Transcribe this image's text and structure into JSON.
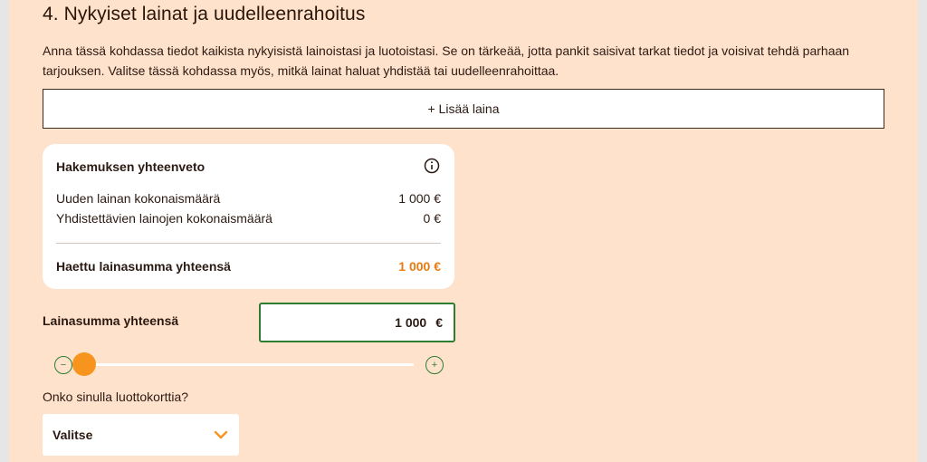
{
  "section": {
    "title": "4. Nykyiset lainat ja uudelleenrahoitus",
    "description": "Anna tässä kohdassa tiedot kaikista nykyisistä lainoistasi ja luotoistasi. Se on tärkeää, jotta pankit saisivat tarkat tiedot ja voisivat tehdä parhaan tarjouksen. Valitse tässä kohdassa myös, mitkä lainat haluat yhdistää tai uudelleenrahoittaa."
  },
  "add_loan": {
    "label": "+ Lisää laina"
  },
  "summary": {
    "heading": "Hakemuksen yhteenveto",
    "rows": [
      {
        "label": "Uuden lainan kokonaismäärä",
        "value": "1 000 €"
      },
      {
        "label": "Yhdistettävien lainojen kokonaismäärä",
        "value": "0 €"
      }
    ],
    "total": {
      "label": "Haettu lainasumma yhteensä",
      "value": "1 000 €"
    }
  },
  "amount": {
    "label": "Lainasumma yhteensä",
    "value": "1 000",
    "unit": "€",
    "slider_fraction": 0.0
  },
  "credit_card": {
    "question": "Onko sinulla luottokorttia?",
    "select_value": "Valitse"
  },
  "colors": {
    "background": "#ffe2cc",
    "accent": "#f7941d",
    "total_value": "#e87a10",
    "input_border": "#2e7d32"
  },
  "icons": [
    "info-icon",
    "minus-icon",
    "plus-icon",
    "chevron-down-icon"
  ]
}
